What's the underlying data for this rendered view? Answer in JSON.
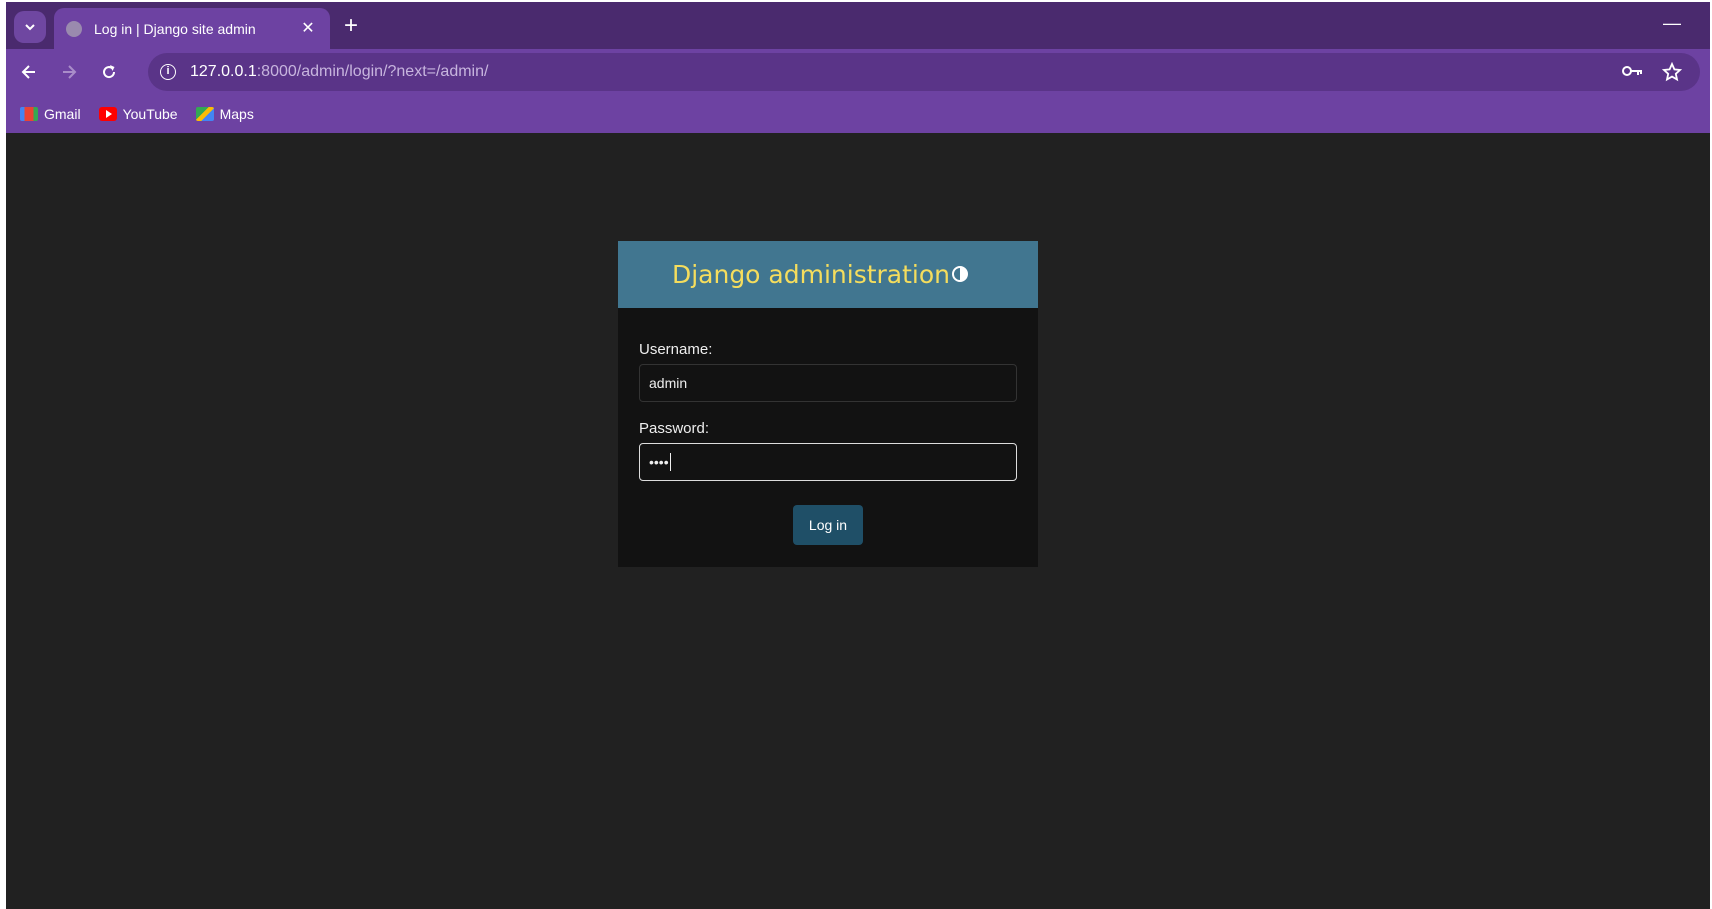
{
  "browser": {
    "tab_title": "Log in | Django site admin",
    "tab_close": "✕",
    "new_tab": "+",
    "minimize": "—",
    "url_host": "127.0.0.1",
    "url_rest": ":8000/admin/login/?next=/admin/",
    "bookmarks": [
      {
        "label": "Gmail",
        "icon": "gmail-icon"
      },
      {
        "label": "YouTube",
        "icon": "youtube-icon"
      },
      {
        "label": "Maps",
        "icon": "maps-icon"
      }
    ],
    "colors": {
      "tabstrip": "#4a2a6e",
      "toolbar": "#6d42a2"
    }
  },
  "login": {
    "header_title": "Django administration",
    "username_label": "Username:",
    "username_value": "admin",
    "password_label": "Password:",
    "password_masked": "••••",
    "submit_label": "Log in",
    "colors": {
      "header_bg": "#417690",
      "header_text": "#f5dd5d",
      "button_bg": "#1f4f67"
    }
  }
}
